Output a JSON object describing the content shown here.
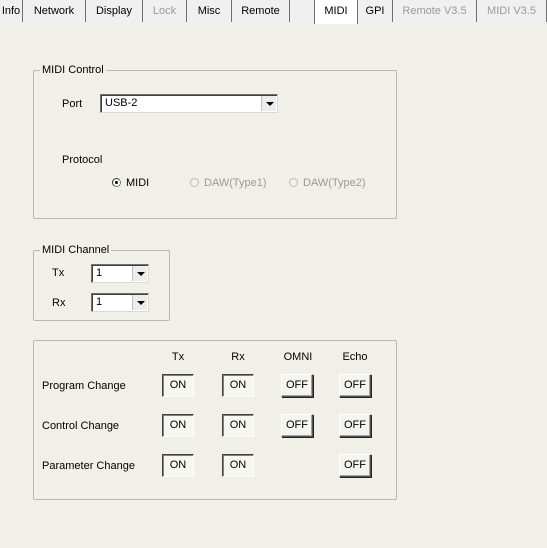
{
  "tabs": [
    {
      "label": "Info",
      "state": "normal"
    },
    {
      "label": "Network",
      "state": "normal"
    },
    {
      "label": "Display",
      "state": "normal"
    },
    {
      "label": "Lock",
      "state": "disabled"
    },
    {
      "label": "Misc",
      "state": "normal"
    },
    {
      "label": "Remote",
      "state": "normal"
    },
    {
      "label": "MIDI",
      "state": "active"
    },
    {
      "label": "GPI",
      "state": "normal"
    },
    {
      "label": "Remote V3.5",
      "state": "disabled"
    },
    {
      "label": "MIDI V3.5",
      "state": "disabled"
    }
  ],
  "midi_control": {
    "title": "MIDI Control",
    "port_label": "Port",
    "port_value": "USB-2",
    "protocol_label": "Protocol",
    "protocols": [
      {
        "label": "MIDI",
        "selected": true,
        "enabled": true
      },
      {
        "label": "DAW(Type1)",
        "selected": false,
        "enabled": false
      },
      {
        "label": "DAW(Type2)",
        "selected": false,
        "enabled": false
      }
    ]
  },
  "midi_channel": {
    "title": "MIDI Channel",
    "tx_label": "Tx",
    "tx_value": "1",
    "rx_label": "Rx",
    "rx_value": "1"
  },
  "toggles": {
    "headers": {
      "tx": "Tx",
      "rx": "Rx",
      "omni": "OMNI",
      "echo": "Echo"
    },
    "rows": [
      {
        "label": "Program Change",
        "tx": "ON",
        "rx": "ON",
        "omni": "OFF",
        "echo": "OFF"
      },
      {
        "label": "Control Change",
        "tx": "ON",
        "rx": "ON",
        "omni": "OFF",
        "echo": "OFF"
      },
      {
        "label": "Parameter Change",
        "tx": "ON",
        "rx": "ON",
        "echo": "OFF"
      }
    ]
  }
}
